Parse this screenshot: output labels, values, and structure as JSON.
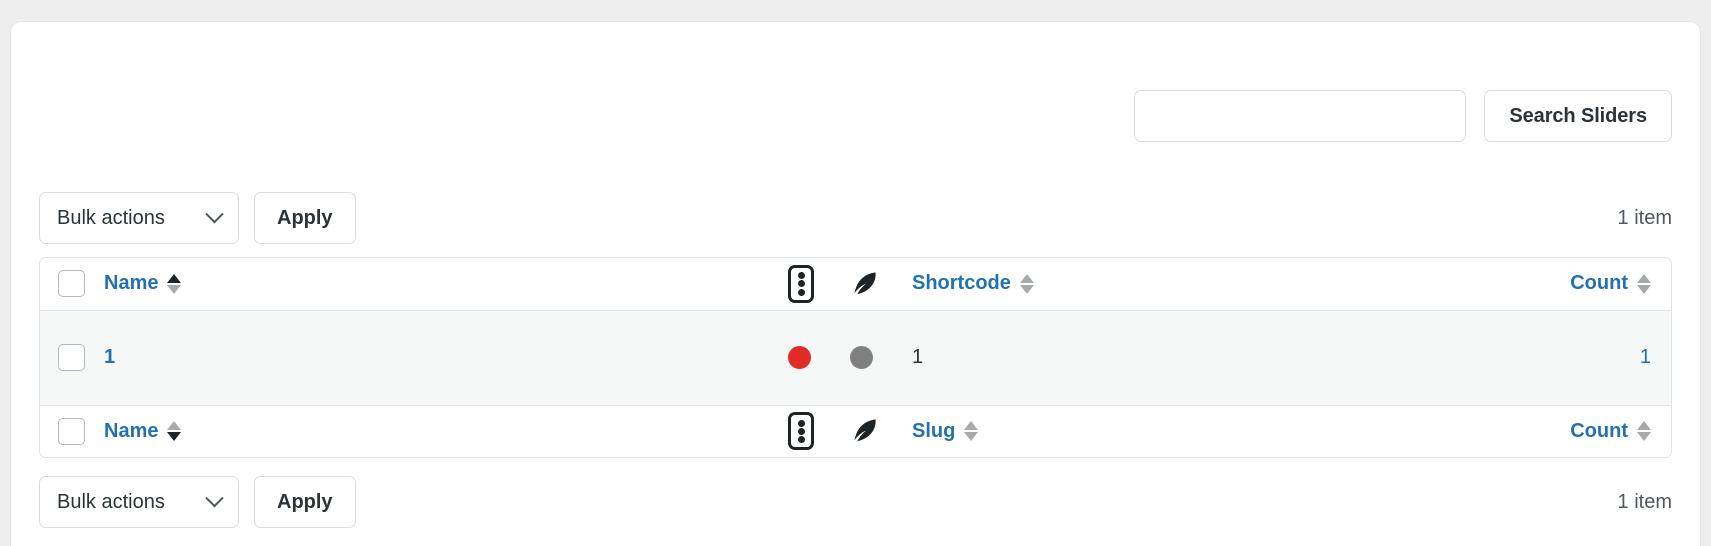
{
  "search": {
    "input_value": "",
    "placeholder": "",
    "button_label": "Search Sliders"
  },
  "bulk_top": {
    "select_label": "Bulk actions",
    "apply_label": "Apply",
    "item_count": "1 item"
  },
  "bulk_bottom": {
    "select_label": "Bulk actions",
    "apply_label": "Apply",
    "item_count": "1 item"
  },
  "table": {
    "header": {
      "name": "Name",
      "status_icon": "traffic-light-icon",
      "pen_icon": "feather-pen-icon",
      "shortcode": "Shortcode",
      "count": "Count"
    },
    "footer": {
      "name": "Name",
      "status_icon": "traffic-light-icon",
      "pen_icon": "feather-pen-icon",
      "slug": "Slug",
      "count": "Count"
    },
    "rows": [
      {
        "name": "1",
        "status_dot": "red",
        "pen_dot": "gray",
        "shortcode": "1",
        "count": "1"
      }
    ]
  },
  "colors": {
    "link": "#2271b1",
    "status_red": "#e02b27",
    "status_gray": "#808080",
    "row_bg": "#f6f7f7",
    "page_bg": "#eeeeee"
  }
}
